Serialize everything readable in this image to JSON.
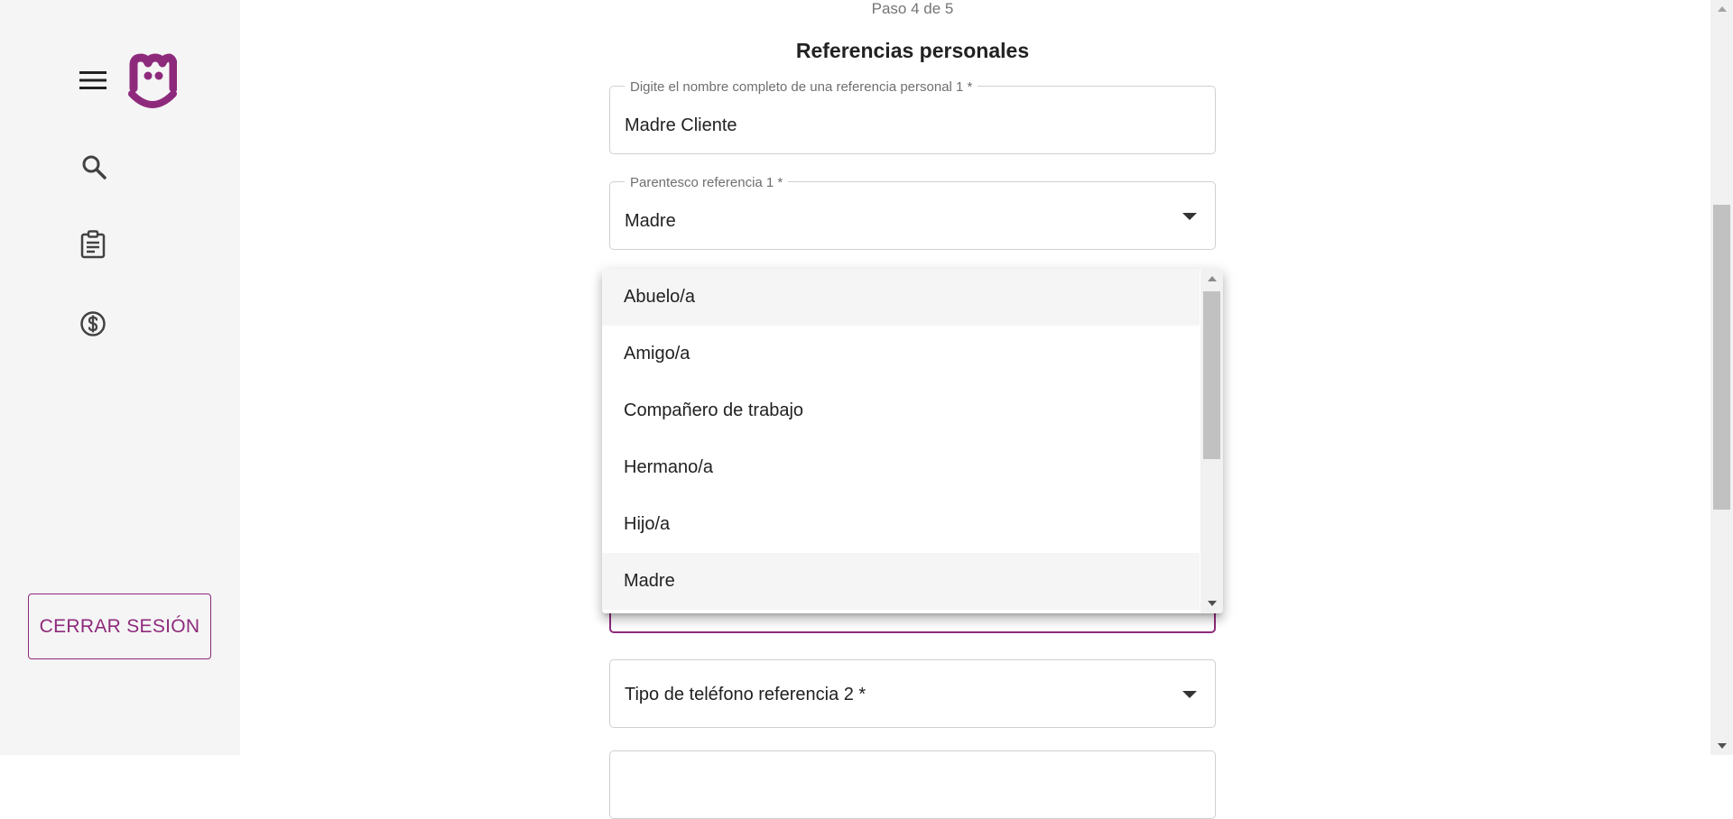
{
  "sidebar": {
    "icons": [
      "menu-icon",
      "brand-logo",
      "search-icon",
      "clipboard-icon",
      "money-icon"
    ],
    "logout_label": "CERRAR SESIÓN"
  },
  "form": {
    "step_text": "Paso 4 de 5",
    "title": "Referencias personales",
    "reference1_name": {
      "label": "Digite el nombre completo de una referencia personal 1 *",
      "value": "Madre Cliente"
    },
    "reference1_relationship": {
      "label": "Parentesco referencia 1 *",
      "value": "Madre"
    },
    "phone_type_ref2": {
      "placeholder": "Tipo de teléfono referencia 2 *"
    }
  },
  "dropdown": {
    "options": [
      "Abuelo/a",
      "Amigo/a",
      "Compañero de trabajo",
      "Hermano/a",
      "Hijo/a",
      "Madre"
    ],
    "selected": "Madre"
  },
  "colors": {
    "brand": "#8e2a7c",
    "sidebar_bg": "#f5f5f5",
    "border": "#d0d0d0"
  }
}
